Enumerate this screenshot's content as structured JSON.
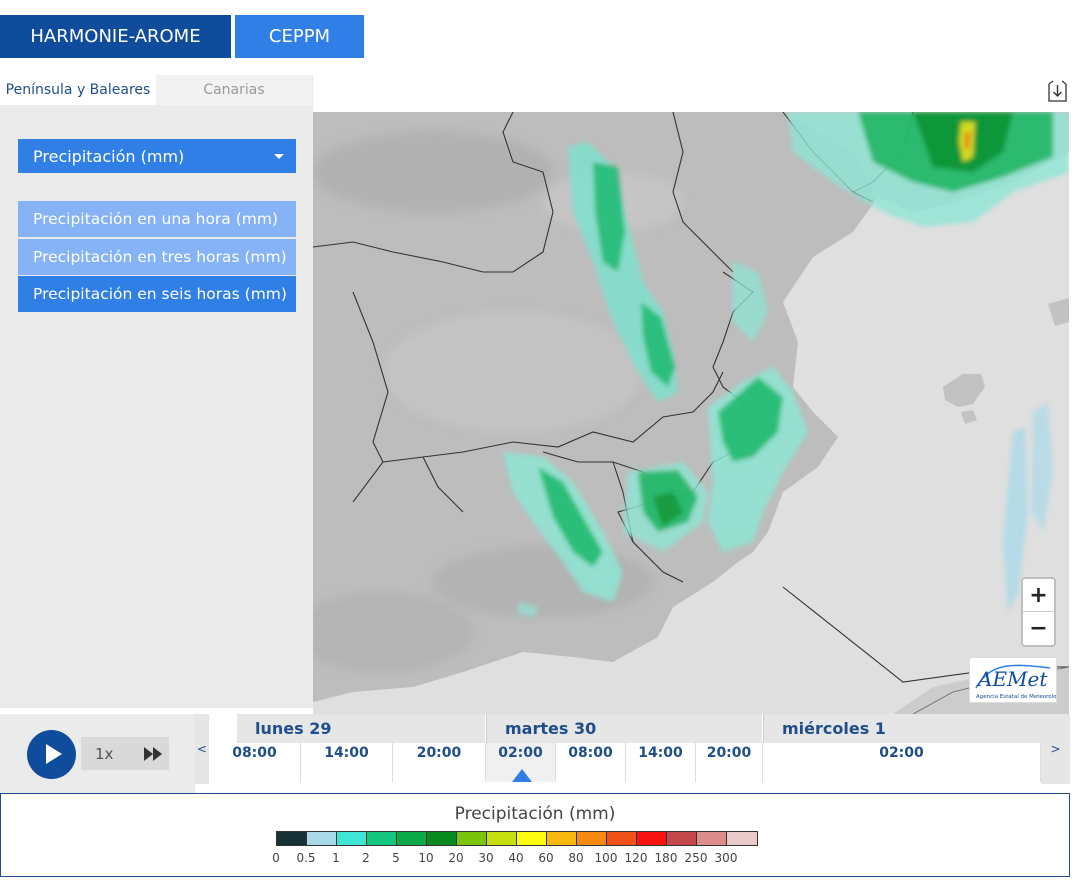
{
  "models": {
    "active": "HARMONIE-AROME",
    "other": "CEPPM"
  },
  "regions": {
    "active": "Península y Baleares",
    "inactive": "Canarias"
  },
  "variable_select": {
    "label": "Precipitación (mm)"
  },
  "sub_options": [
    "Precipitación en una hora (mm)",
    "Precipitación en tres horas (mm)",
    "Precipitación en seis horas (mm)"
  ],
  "selected_sub_option": 2,
  "zoom": {
    "in": "+",
    "out": "−"
  },
  "logo": {
    "text": "AEMet",
    "subtitle": "Agencia Estatal de Meteorología"
  },
  "player": {
    "speed": "1x"
  },
  "timeline": {
    "prev": "<",
    "next": ">",
    "days": [
      "lunes 29",
      "martes 30",
      "miércoles 1"
    ],
    "slots": [
      "08:00",
      "14:00",
      "20:00",
      "02:00",
      "08:00",
      "14:00",
      "20:00",
      "02:00"
    ],
    "selected": "02:00"
  },
  "legend": {
    "title": "Precipitación (mm)",
    "labels": [
      "0",
      "0.5",
      "1",
      "2",
      "5",
      "10",
      "20",
      "30",
      "40",
      "60",
      "80",
      "100",
      "120",
      "180",
      "250",
      "300"
    ],
    "colors": [
      "#163236",
      "#a9d9e8",
      "#3ee6d6",
      "#13c87e",
      "#0daa4a",
      "#0a8a1e",
      "#7bc40e",
      "#c4e010",
      "#fcfc10",
      "#f7b910",
      "#f58a10",
      "#f0521a",
      "#f5120f",
      "#c4474c",
      "#dd8c8c",
      "#ebcaca"
    ]
  },
  "colors": {
    "brand_dark": "#0f4c9c",
    "brand": "#2f7fe6",
    "brand_light": "#86b3f5"
  }
}
